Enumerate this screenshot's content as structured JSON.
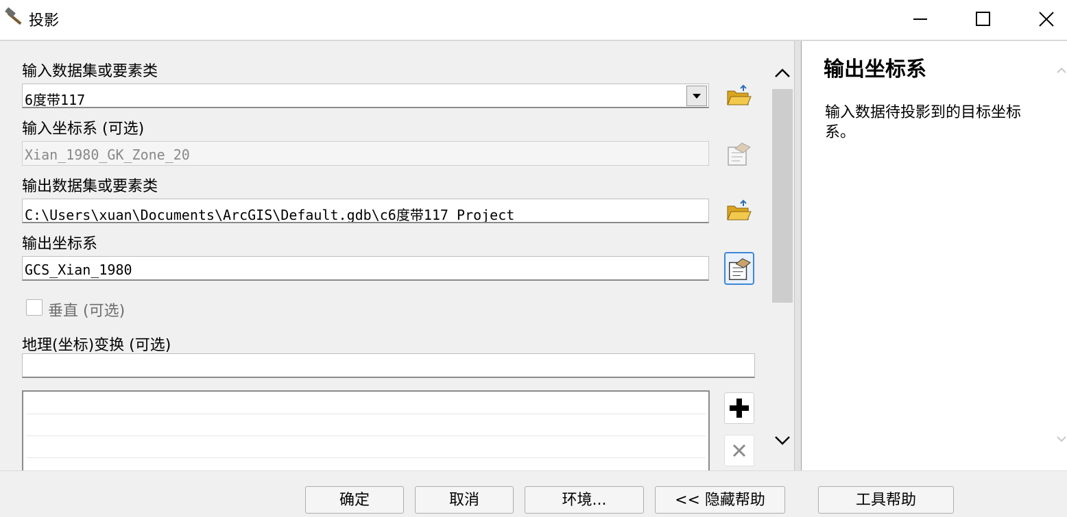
{
  "window": {
    "title": "投影"
  },
  "form": {
    "input_dataset_label": "输入数据集或要素类",
    "input_dataset_value": "6度带117",
    "input_cs_label": "输入坐标系 (可选)",
    "input_cs_value": "Xian_1980_GK_Zone_20",
    "output_dataset_label": "输出数据集或要素类",
    "output_dataset_value": "C:\\Users\\xuan\\Documents\\ArcGIS\\Default.gdb\\c6度带117_Project",
    "output_cs_label": "输出坐标系",
    "output_cs_value": "GCS_Xian_1980",
    "vertical_label": "垂直 (可选)",
    "geo_transform_label": "地理(坐标)变换 (可选)",
    "geo_transform_value": ""
  },
  "help": {
    "title": "输出坐标系",
    "body": "输入数据待投影到的目标坐标系。"
  },
  "buttons": {
    "ok": "确定",
    "cancel": "取消",
    "env": "环境...",
    "hide_help": "<< 隐藏帮助",
    "tool_help": "工具帮助"
  }
}
